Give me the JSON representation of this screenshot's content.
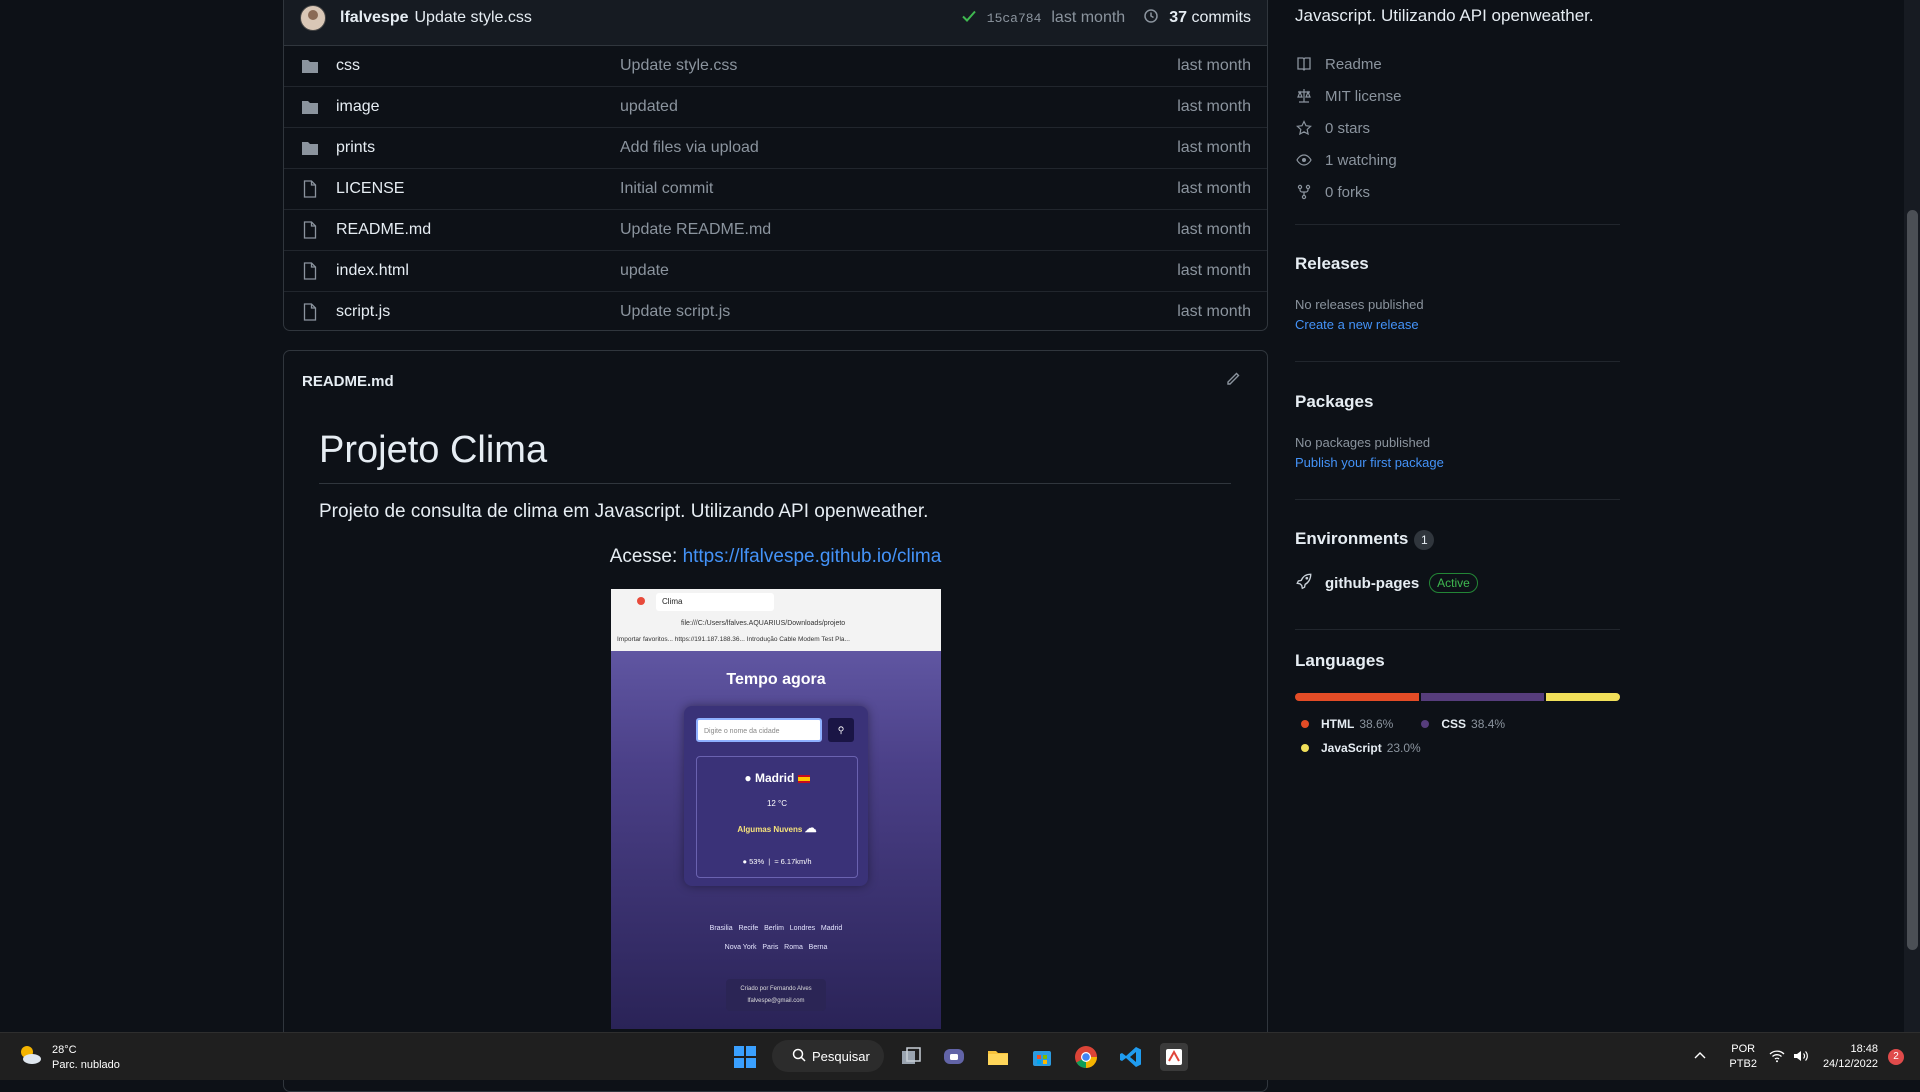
{
  "latest_commit": {
    "author": "lfalvespe",
    "message": "Update style.css",
    "hash": "15ca784",
    "date": "last month",
    "commits_count": "37",
    "commits_label": "commits"
  },
  "files": [
    {
      "type": "folder",
      "name": "css",
      "message": "Update style.css",
      "date": "last month"
    },
    {
      "type": "folder",
      "name": "image",
      "message": "updated",
      "date": "last month"
    },
    {
      "type": "folder",
      "name": "prints",
      "message": "Add files via upload",
      "date": "last month"
    },
    {
      "type": "file",
      "name": "LICENSE",
      "message": "Initial commit",
      "date": "last month"
    },
    {
      "type": "file",
      "name": "README.md",
      "message": "Update README.md",
      "date": "last month"
    },
    {
      "type": "file",
      "name": "index.html",
      "message": "update",
      "date": "last month"
    },
    {
      "type": "file",
      "name": "script.js",
      "message": "Update script.js",
      "date": "last month"
    }
  ],
  "readme": {
    "filename": "README.md",
    "title": "Projeto Clima",
    "description": "Projeto de consulta de clima em Javascript. Utilizando API openweather.",
    "access_label": "Acesse:",
    "access_link": "https://lfalvespe.github.io/clima",
    "screenshot": {
      "tab_title": "Clima",
      "url": "file:///C:/Users/lfalves.AQUARIUS/Downloads/projeto",
      "bookmarks": "Importar favoritos...   https://191.187.188.36...   Introdução   Cable Modem Test Pla...",
      "app_title": "Tempo agora",
      "input_placeholder": "Digite o nome da cidade",
      "city": "Madrid",
      "temp": "12 °C",
      "weather_desc": "Algumas Nuvens",
      "humidity": "53%",
      "wind": "6.17km/h",
      "cities_line1": "Brasilia   Recife   Berlim   Londres   Madrid",
      "cities_line2": "Nova York   Paris   Roma   Berna",
      "footer_line1": "Criado por Fernando Alves",
      "footer_line2": "lfalvespe@gmail.com"
    }
  },
  "sidebar": {
    "about_tail": "Javascript. Utilizando API openweather.",
    "meta": [
      {
        "icon": "book-icon",
        "label": "Readme"
      },
      {
        "icon": "law-icon",
        "label": "MIT license"
      },
      {
        "icon": "star-icon",
        "label": "0 stars"
      },
      {
        "icon": "eye-icon",
        "label": "1 watching"
      },
      {
        "icon": "fork-icon",
        "label": "0 forks"
      }
    ],
    "releases": {
      "title": "Releases",
      "text": "No releases published",
      "link": "Create a new release"
    },
    "packages": {
      "title": "Packages",
      "text": "No packages published",
      "link": "Publish your first package"
    },
    "environments": {
      "title": "Environments",
      "count": "1",
      "name": "github-pages",
      "status": "Active"
    },
    "languages": {
      "title": "Languages",
      "items": [
        {
          "name": "HTML",
          "percent": "38.6%",
          "value": 38.6,
          "color": "#e34c26"
        },
        {
          "name": "CSS",
          "percent": "38.4%",
          "value": 38.4,
          "color": "#563d7c"
        },
        {
          "name": "JavaScript",
          "percent": "23.0%",
          "value": 23.0,
          "color": "#f1e05a"
        }
      ]
    }
  },
  "taskbar": {
    "weather_temp": "28°C",
    "weather_desc": "Parc. nublado",
    "search_label": "Pesquisar",
    "lang_top": "POR",
    "lang_bottom": "PTB2",
    "time": "18:48",
    "date": "24/12/2022",
    "notifications": "2"
  },
  "colors": {
    "background": "#0d1117",
    "link": "#4493f8",
    "active_green": "#3fb950"
  }
}
